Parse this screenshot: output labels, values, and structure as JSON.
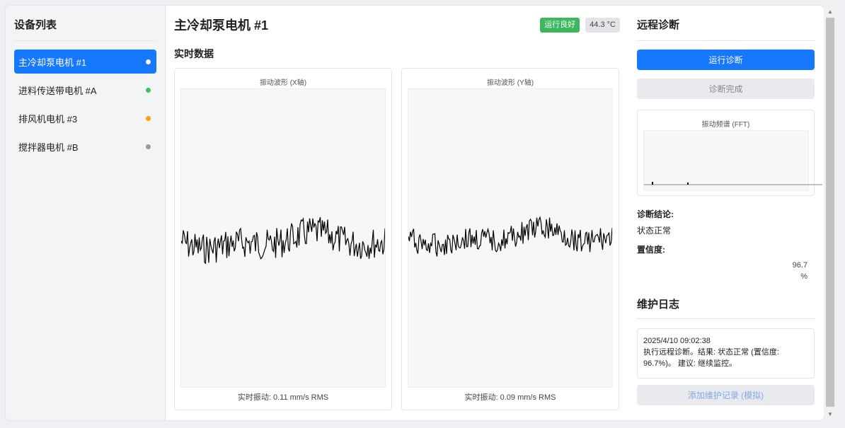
{
  "sidebar": {
    "title": "设备列表",
    "items": [
      {
        "label": "主冷却泵电机 #1",
        "status_color": "#ffffff"
      },
      {
        "label": "进料传送带电机 #A",
        "status_color": "#34c759"
      },
      {
        "label": "排风机电机 #3",
        "status_color": "#ff9f0a"
      },
      {
        "label": "搅拌器电机 #B",
        "status_color": "#9a9a9a"
      }
    ]
  },
  "main": {
    "title": "主冷却泵电机 #1",
    "status_badge": "运行良好",
    "temperature": "44.3 °C",
    "section_title": "实时数据",
    "chart_x": {
      "title": "振动波形 (X轴)",
      "footer": "实时振动: 0.11 mm/s RMS"
    },
    "chart_y": {
      "title": "振动波形 (Y轴)",
      "footer": "实时振动: 0.09 mm/s RMS"
    }
  },
  "right": {
    "title": "远程诊断",
    "run_button": "运行诊断",
    "done_button": "诊断完成",
    "fft_title": "振动频谱 (FFT)",
    "conclusion_label": "诊断结论:",
    "conclusion_value": "状态正常",
    "confidence_label": "置信度:",
    "confidence_value_line1": "96.7",
    "confidence_value_line2": "%",
    "log_title": "维护日志",
    "log_entry": {
      "time": "2025/4/10 09:02:38",
      "text": "执行远程诊断。结果: 状态正常 (置信度: 96.7%)。 建议: 继续监控。"
    },
    "add_log_button": "添加维护记录 (模拟)"
  },
  "colors": {
    "accent": "#1677ff",
    "good": "#3bb85b"
  }
}
